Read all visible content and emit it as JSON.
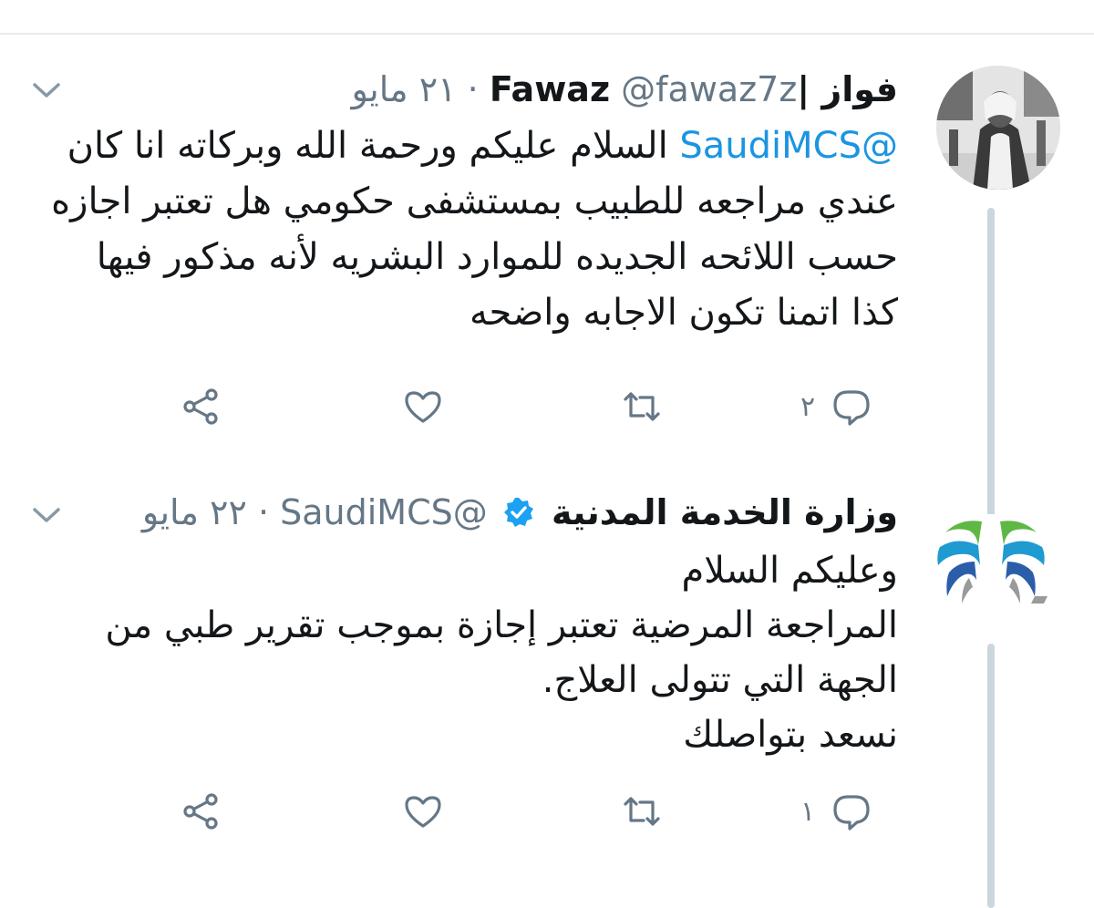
{
  "tweets": [
    {
      "author_name": "فواز |Fawaz",
      "handle": "@fawaz7z",
      "separator": "·",
      "time": "٢١ مايو",
      "mention": "@SaudiMCS",
      "lines": [
        " السلام عليكم ورحمة الله وبركاته انا كان",
        "عندي مراجعه للطبيب بمستشفى حكومي هل تعتبر اجازه",
        "حسب اللائحه الجديده للموارد البشريه لأنه مذكور فيها",
        "كذا اتمنا تكون الاجابه واضحه"
      ],
      "reply_count": "٢",
      "avatar_icon": "profile-photo",
      "verified": false
    },
    {
      "author_name": "وزارة الخدمة المدنية",
      "handle": "@SaudiMCS",
      "separator": "·",
      "time": "٢٢ مايو",
      "lines": [
        "وعليكم السلام",
        "المراجعة المرضية تعتبر إجازة بموجب تقرير طبي من",
        "الجهة التي تتولى العلاج.",
        "نسعد بتواصلك"
      ],
      "reply_count": "١",
      "avatar_icon": "ministry-logo",
      "verified": true
    }
  ],
  "icons": {
    "reply": "reply-icon",
    "retweet": "retweet-icon",
    "like": "heart-icon",
    "share": "share-icon",
    "caret": "chevron-down-icon",
    "verified": "verified-badge-icon"
  },
  "colors": {
    "icon_gray": "#657786",
    "link_blue": "#1b95e0",
    "verified_blue": "#1da1f2",
    "thread_line": "#ccd6dd"
  }
}
